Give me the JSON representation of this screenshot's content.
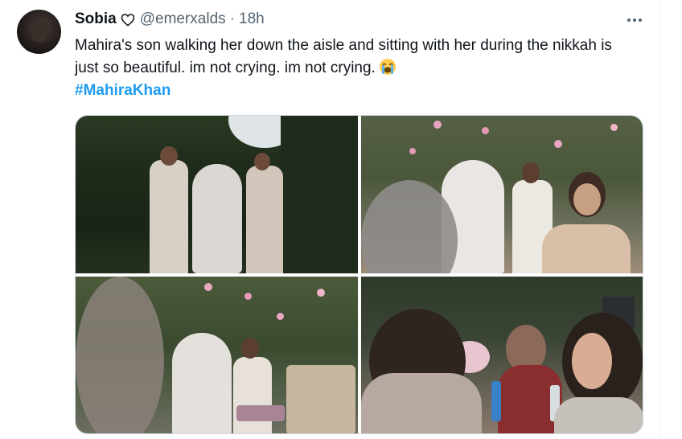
{
  "tweet": {
    "author_name": "Sobia",
    "handle": "@emerxalds",
    "separator": "·",
    "time": "18h",
    "text": "Mahira's son walking her down the aisle and sitting with her during the nikkah is just so beautiful. im not crying. im not crying.",
    "hashtag": "#MahiraKhan",
    "emoji_icon": "loudly-crying-face-emoji"
  },
  "colors": {
    "link": "#1d9bf0",
    "secondary_text": "#536471",
    "primary_text": "#0f1419"
  },
  "media": {
    "photo_count": 4
  }
}
